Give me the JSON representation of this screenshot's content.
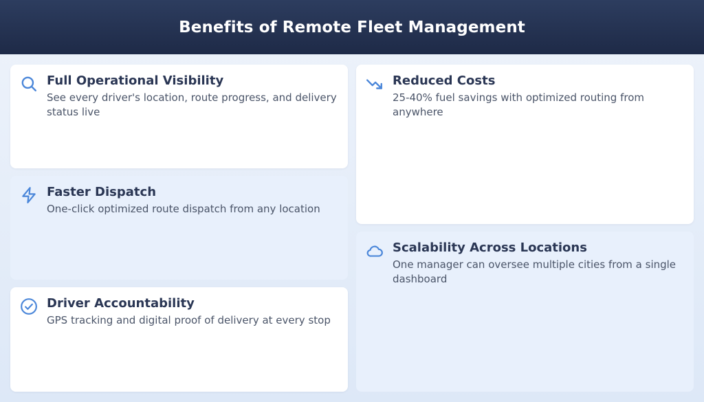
{
  "header": {
    "title": "Benefits of Remote Fleet Management"
  },
  "cards": [
    {
      "icon": "search-icon",
      "title": "Full Operational Visibility",
      "description": "See every driver's location, route progress, and delivery status live"
    },
    {
      "icon": "lightning-icon",
      "title": "Faster Dispatch",
      "description": "One-click optimized route dispatch from any location"
    },
    {
      "icon": "check-circle-icon",
      "title": "Driver Accountability",
      "description": "GPS tracking and digital proof of delivery at every stop"
    },
    {
      "icon": "trending-down-icon",
      "title": "Reduced Costs",
      "description": "25-40% fuel savings with optimized routing from anywhere"
    },
    {
      "icon": "cloud-icon",
      "title": "Scalability Across Locations",
      "description": "One manager can oversee multiple cities from a single dashboard"
    }
  ],
  "colors": {
    "header_bg": "#1e2a47",
    "accent": "#4a86d9",
    "title_text": "#2a3654"
  }
}
